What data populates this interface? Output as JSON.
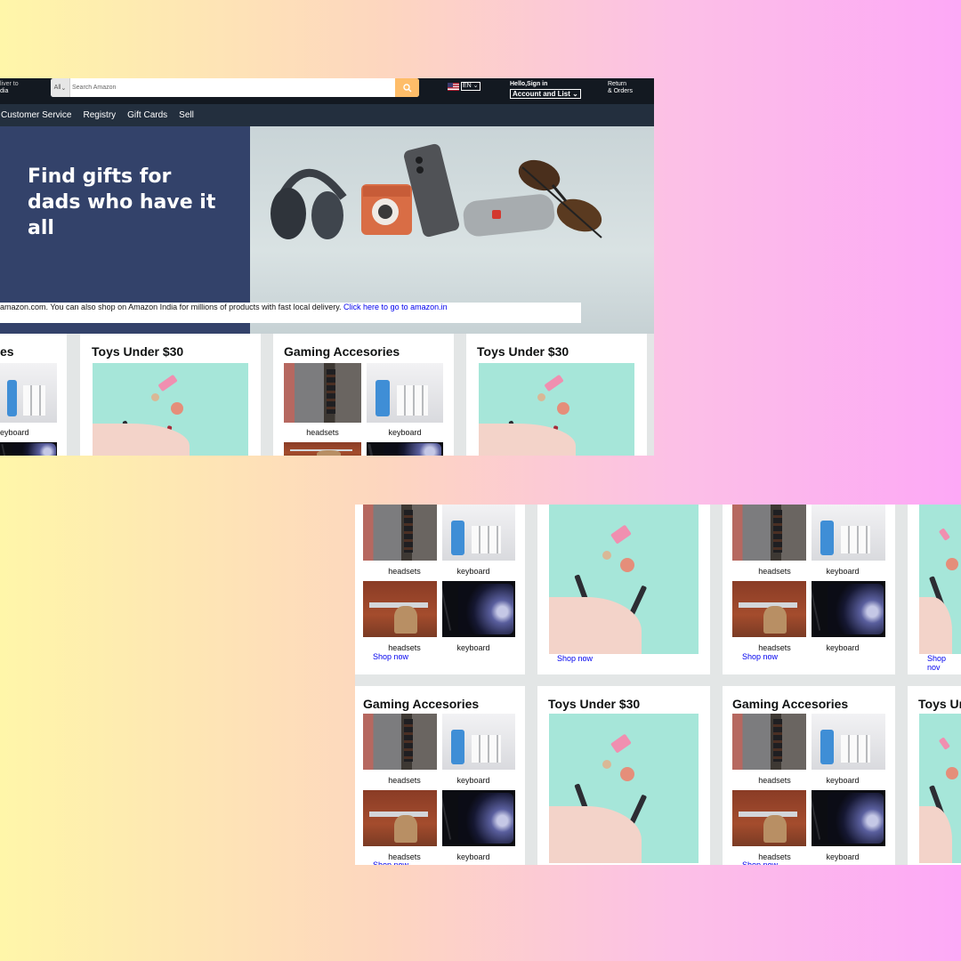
{
  "header": {
    "deliver_line1": "liver to",
    "deliver_line2": "dia",
    "search_category": "All",
    "search_placeholder": "Search Amazon",
    "language": "EN",
    "greeting": "Hello,Sign in",
    "account_label": "Account and List",
    "returns_line1": "Return",
    "returns_line2": "& Orders"
  },
  "subnav": [
    "Customer Service",
    "Registry",
    "Gift Cards",
    "Sell"
  ],
  "hero": {
    "title_line1": "Find gifts for",
    "title_line2": "dads who have it all"
  },
  "notice": {
    "text": "amazon.com. You can also shop on Amazon India for millions of products with fast local delivery. ",
    "link": "Click here to go to amazon.in"
  },
  "shot1_cards": {
    "partial_title": "es",
    "partial_label": "eyboard",
    "card2_title": "Toys Under $30",
    "card3_title": "Gaming Accesories",
    "card3_label1": "headsets",
    "card3_label2": "keyboard",
    "card4_title": "Toys Under $30"
  },
  "shot2_cards": {
    "gaming_title": "Gaming Accesories",
    "toys_title": "Toys Under $30",
    "toys_partial_title": "Toys Ur",
    "headsets": "headsets",
    "keyboard": "keyboard",
    "shop_now": "Shop now",
    "shop_now_partial": "Shop nov"
  }
}
